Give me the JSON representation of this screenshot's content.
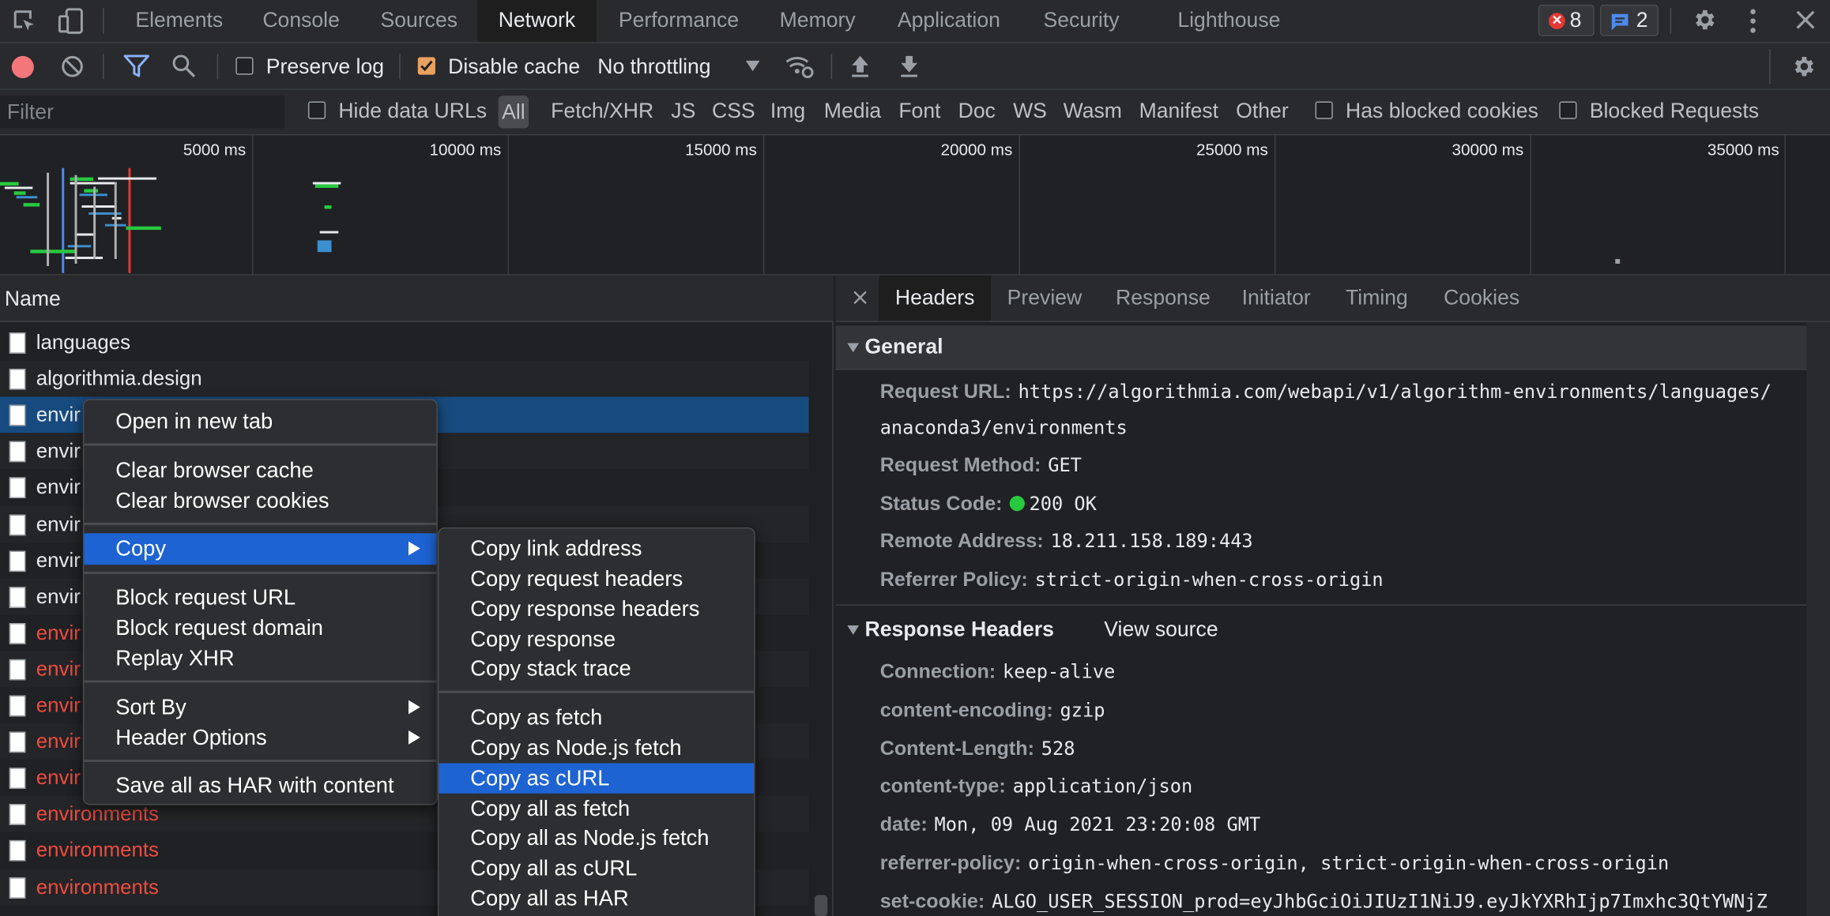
{
  "tabs": [
    "Elements",
    "Console",
    "Sources",
    "Network",
    "Performance",
    "Memory",
    "Application",
    "Security",
    "Lighthouse"
  ],
  "badges": {
    "errors": "8",
    "messages": "2"
  },
  "toolbar": {
    "preserve_log": "Preserve log",
    "disable_cache": "Disable cache",
    "throttling": "No throttling"
  },
  "filter": {
    "placeholder": "Filter",
    "hide_data_urls": "Hide data URLs",
    "types": [
      "All",
      "Fetch/XHR",
      "JS",
      "CSS",
      "Img",
      "Media",
      "Font",
      "Doc",
      "WS",
      "Wasm",
      "Manifest",
      "Other"
    ],
    "has_blocked_cookies": "Has blocked cookies",
    "blocked_requests": "Blocked Requests"
  },
  "timeline": {
    "labels": [
      "5000 ms",
      "10000 ms",
      "15000 ms",
      "20000 ms",
      "25000 ms",
      "30000 ms",
      "35000 ms"
    ]
  },
  "requests": {
    "header": "Name",
    "rows": [
      {
        "name": "languages"
      },
      {
        "name": "algorithmia.design"
      },
      {
        "name": "envir"
      },
      {
        "name": "envir"
      },
      {
        "name": "envir"
      },
      {
        "name": "envir"
      },
      {
        "name": "envir"
      },
      {
        "name": "envir"
      },
      {
        "name": "envir"
      },
      {
        "name": "envir"
      },
      {
        "name": "envir"
      },
      {
        "name": "envir"
      },
      {
        "name": "envir"
      },
      {
        "name": "environments"
      },
      {
        "name": "environments"
      },
      {
        "name": "environments"
      }
    ]
  },
  "details": {
    "tabs": [
      "Headers",
      "Preview",
      "Response",
      "Initiator",
      "Timing",
      "Cookies"
    ],
    "general": {
      "title": "General",
      "request_url_key": "Request URL:",
      "request_url_1": "https://algorithmia.com/webapi/v1/algorithm-environments/languages/",
      "request_url_2": "anaconda3/environments",
      "method_key": "Request Method:",
      "method": "GET",
      "status_key": "Status Code:",
      "status": "200 OK",
      "remote_key": "Remote Address:",
      "remote": "18.211.158.189:443",
      "referrer_key": "Referrer Policy:",
      "referrer": "strict-origin-when-cross-origin"
    },
    "response": {
      "title": "Response Headers",
      "view_source": "View source",
      "headers": [
        {
          "k": "Connection:",
          "v": "keep-alive"
        },
        {
          "k": "content-encoding:",
          "v": "gzip"
        },
        {
          "k": "Content-Length:",
          "v": "528"
        },
        {
          "k": "content-type:",
          "v": "application/json"
        },
        {
          "k": "date:",
          "v": "Mon, 09 Aug 2021 23:20:08 GMT"
        },
        {
          "k": "referrer-policy:",
          "v": "origin-when-cross-origin, strict-origin-when-cross-origin"
        },
        {
          "k": "set-cookie:",
          "v": "ALGO_USER_SESSION_prod=eyJhbGciOiJIUzI1NiJ9.eyJkYXRhIjp7Imxhc3QtYWNjZ"
        }
      ]
    }
  },
  "context_menu": {
    "items": [
      "Open in new tab",
      "Clear browser cache",
      "Clear browser cookies",
      "Copy",
      "Block request URL",
      "Block request domain",
      "Replay XHR",
      "Sort By",
      "Header Options",
      "Save all as HAR with content"
    ]
  },
  "copy_menu": {
    "items": [
      "Copy link address",
      "Copy request headers",
      "Copy response headers",
      "Copy response",
      "Copy stack trace",
      "Copy as fetch",
      "Copy as Node.js fetch",
      "Copy as cURL",
      "Copy all as fetch",
      "Copy all as Node.js fetch",
      "Copy all as cURL",
      "Copy all as HAR"
    ]
  },
  "colors": {
    "accent": "#1e63d2",
    "selected_row": "#174b7f",
    "error_text": "#ee4c40",
    "status_ok": "#27c93f",
    "checkbox_on": "#e8a15f"
  }
}
